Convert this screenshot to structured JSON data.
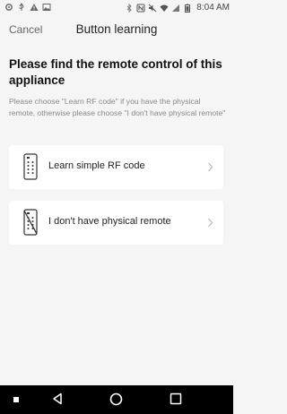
{
  "status_bar": {
    "time": "8:04 AM",
    "left_icons": [
      "settings-icon",
      "usb-icon",
      "warning-icon",
      "image-icon"
    ],
    "right_icons": [
      "bluetooth-icon",
      "nfc-icon",
      "mute-icon",
      "wifi-icon",
      "signal-icon",
      "battery-icon"
    ]
  },
  "header": {
    "cancel_label": "Cancel",
    "title": "Button learning"
  },
  "content": {
    "heading": "Please find the remote control of this appliance",
    "description": "Please choose \"Learn RF code\" if you have the physical remote, otherwise please choose \"I don't have physical remote\""
  },
  "options": [
    {
      "label": "Learn simple RF code",
      "icon": "remote-icon"
    },
    {
      "label": "I don't have physical remote",
      "icon": "no-remote-icon"
    }
  ],
  "nav_bar": {
    "items": [
      "square-dot-icon",
      "back-icon",
      "home-icon",
      "recents-icon"
    ]
  }
}
